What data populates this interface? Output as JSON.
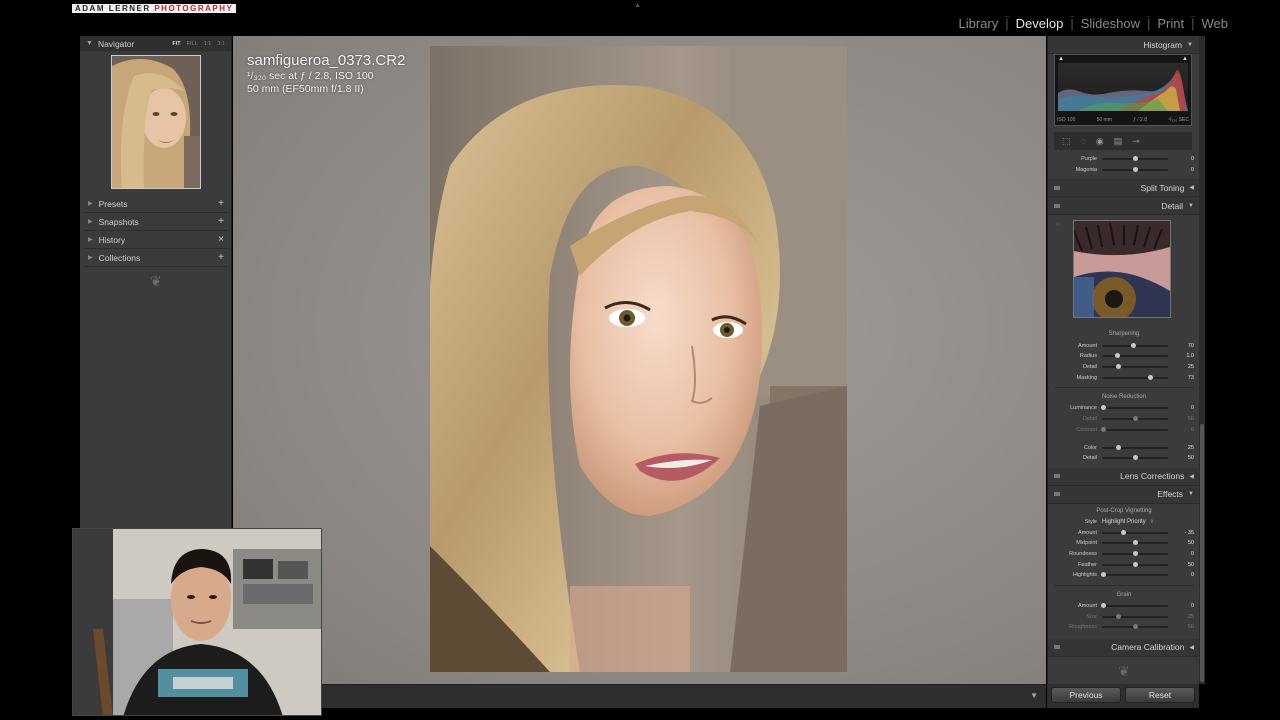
{
  "app": {
    "brand_left": "ADAM LERNER",
    "brand_right": "PHOTOGRAPHY",
    "modules": [
      "Library",
      "Develop",
      "Slideshow",
      "Print",
      "Web"
    ],
    "active_module": "Develop"
  },
  "left_panel": {
    "navigator": {
      "title": "Navigator",
      "zoom": [
        "FIT",
        "FILL",
        "1:1",
        "3:1"
      ]
    },
    "sections": [
      {
        "label": "Presets",
        "action": "+"
      },
      {
        "label": "Snapshots",
        "action": "+"
      },
      {
        "label": "History",
        "action": "×"
      },
      {
        "label": "Collections",
        "action": "+"
      }
    ]
  },
  "photo_info": {
    "filename": "samfigueroa_0373.CR2",
    "exposure": "¹/₃₂₀ sec at ƒ / 2.8, ISO 100",
    "lens": "50 mm (EF50mm f/1.8 II)"
  },
  "right_panel": {
    "histogram": {
      "title": "Histogram",
      "iso": "ISO 100",
      "focal": "50 mm",
      "aperture": "ƒ / 2.8",
      "shutter": "¹/₃₂₀ SEC"
    },
    "hsl_tail": [
      {
        "label": "Purple",
        "value": "0",
        "pos": 0.5
      },
      {
        "label": "Magenta",
        "value": "0",
        "pos": 0.5
      }
    ],
    "split_toning": "Split Toning",
    "detail": {
      "title": "Detail",
      "sharpening": {
        "title": "Sharpening",
        "rows": [
          {
            "label": "Amount",
            "value": "70",
            "pos": 0.47
          },
          {
            "label": "Radius",
            "value": "1.0",
            "pos": 0.24
          },
          {
            "label": "Detail",
            "value": "25",
            "pos": 0.25
          },
          {
            "label": "Masking",
            "value": "73",
            "pos": 0.73
          }
        ]
      },
      "noise_reduction": {
        "title": "Noise Reduction",
        "rows": [
          {
            "label": "Luminance",
            "value": "0",
            "pos": 0.0,
            "dim": false
          },
          {
            "label": "Detail",
            "value": "50",
            "pos": 0.5,
            "dim": true
          },
          {
            "label": "Contrast",
            "value": "0",
            "pos": 0.0,
            "dim": true
          },
          {
            "label": "Color",
            "value": "25",
            "pos": 0.25,
            "dim": false
          },
          {
            "label": "Detail",
            "value": "50",
            "pos": 0.5,
            "dim": false
          }
        ]
      }
    },
    "lens_corrections": "Lens Corrections",
    "effects": {
      "title": "Effects",
      "vignette": {
        "title": "Post-Crop Vignetting",
        "style_label": "Style",
        "style_value": "Highlight Priority",
        "rows": [
          {
            "label": "Amount",
            "value": "- 35",
            "pos": 0.32
          },
          {
            "label": "Midpoint",
            "value": "50",
            "pos": 0.5
          },
          {
            "label": "Roundness",
            "value": "0",
            "pos": 0.5
          },
          {
            "label": "Feather",
            "value": "50",
            "pos": 0.5
          },
          {
            "label": "Highlights",
            "value": "0",
            "pos": 0.0
          }
        ]
      },
      "grain": {
        "title": "Grain",
        "rows": [
          {
            "label": "Amount",
            "value": "0",
            "pos": 0.0,
            "dim": false
          },
          {
            "label": "Size",
            "value": "25",
            "pos": 0.25,
            "dim": true
          },
          {
            "label": "Roughness",
            "value": "50",
            "pos": 0.5,
            "dim": true
          }
        ]
      }
    },
    "camera_calibration": "Camera Calibration",
    "buttons": {
      "previous": "Previous",
      "reset": "Reset"
    }
  },
  "colors": {
    "panel_bg": "#3b3b3b",
    "canvas_bg": "#8b8682",
    "active_module": "#e6e6e6"
  }
}
